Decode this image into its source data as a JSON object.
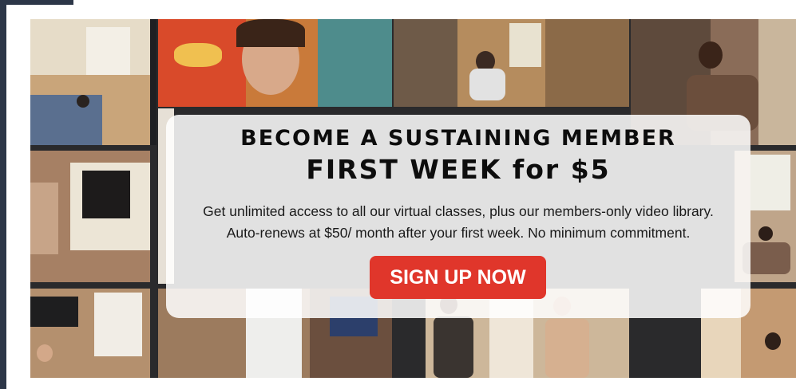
{
  "promo": {
    "headline_line1": "BECOME A SUSTAINING MEMBER",
    "headline_line2": "FIRST WEEK for $5",
    "body_line1": "Get unlimited access to all our virtual classes, plus our members-only video library.",
    "body_line2": "Auto-renews at $50/ month after your first week. No minimum commitment.",
    "cta_label": "SIGN UP NOW"
  },
  "colors": {
    "cta_background": "#e0362b",
    "sidebar": "#2d3748",
    "card_background": "rgba(255,255,255,0.86)"
  }
}
